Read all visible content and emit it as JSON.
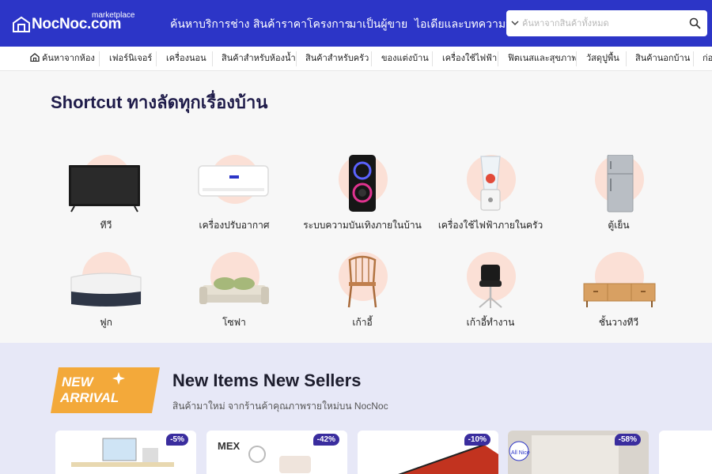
{
  "header": {
    "logo_text": "NocNoc.com",
    "logo_sub": "marketplace",
    "nav": [
      "ค้นหาบริการช่าง",
      "สินค้าราคาโครงการ",
      "มาเป็นผู้ขาย",
      "ไอเดียและบทความน่ารู้"
    ],
    "search_placeholder": "ค้นหาจากสินค้าทั้งหมด"
  },
  "categories": [
    "ค้นหาจากห้อง",
    "เฟอร์นิเจอร์",
    "เครื่องนอน",
    "สินค้าสำหรับห้องน้ำ",
    "สินค้าสำหรับครัว",
    "ของแต่งบ้าน",
    "เครื่องใช้ไฟฟ้า",
    "ฟิตเนสและสุขภาพ",
    "วัสดุปูพื้น",
    "สินค้านอกบ้าน",
    "ก่อ"
  ],
  "shortcut": {
    "title": "Shortcut ทางลัดทุกเรื่องบ้าน",
    "items": [
      {
        "label": "ทีวี",
        "icon": "tv-icon"
      },
      {
        "label": "เครื่องปรับอากาศ",
        "icon": "air-conditioner-icon"
      },
      {
        "label": "ระบบความบันเทิงภายในบ้าน",
        "icon": "speaker-icon"
      },
      {
        "label": "เครื่องใช้ไฟฟ้าภายในครัว",
        "icon": "blender-icon"
      },
      {
        "label": "ตู้เย็น",
        "icon": "fridge-icon"
      },
      {
        "label": "ฟูก",
        "icon": "mattress-icon"
      },
      {
        "label": "โซฟา",
        "icon": "sofa-icon"
      },
      {
        "label": "เก้าอี้",
        "icon": "chair-icon"
      },
      {
        "label": "เก้าอี้ทำงาน",
        "icon": "office-chair-icon"
      },
      {
        "label": "ชั้นวางทีวี",
        "icon": "tv-stand-icon"
      }
    ]
  },
  "new_items": {
    "badge_line1": "NEW",
    "badge_line2": "ARRIVAL",
    "title": "New Items New Sellers",
    "subtitle": "สินค้ามาใหม่ จากร้านค้าคุณภาพรายใหม่บน NocNoc",
    "products": [
      {
        "discount": "-5%"
      },
      {
        "discount": "-42%",
        "brand": "MEX"
      },
      {
        "discount": "-10%"
      },
      {
        "discount": "-58%",
        "brand": "All Nice"
      }
    ]
  },
  "colors": {
    "brand": "#2c35c7",
    "halo": "#fbe0d6",
    "discount": "#3a2d9e",
    "badge": "#f3a93a"
  }
}
